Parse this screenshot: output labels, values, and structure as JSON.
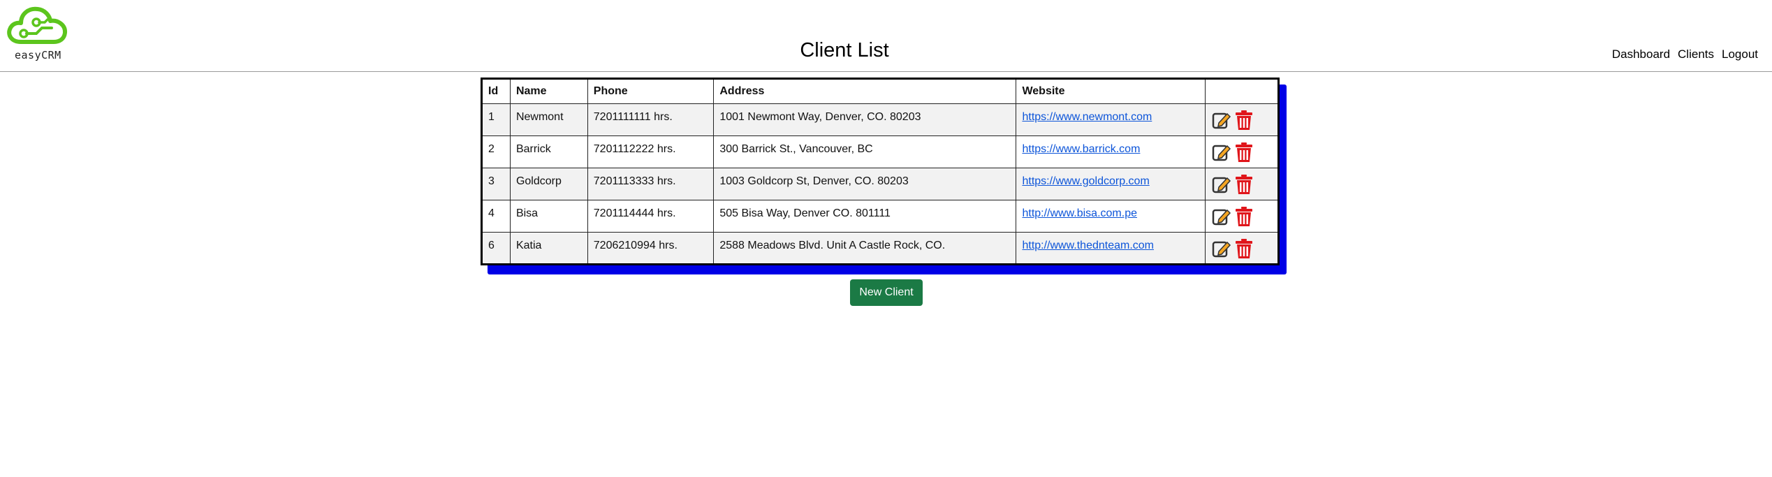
{
  "brand": {
    "name": "easyCRM",
    "logo_color": "#5cc51d"
  },
  "page_title": "Client List",
  "nav": [
    "Dashboard",
    "Clients",
    "Logout"
  ],
  "table": {
    "columns": [
      "Id",
      "Name",
      "Phone",
      "Address",
      "Website",
      ""
    ],
    "rows": [
      {
        "id": "1",
        "name": "Newmont",
        "phone": "7201111111 hrs.",
        "address": "1001 Newmont Way, Denver, CO. 80203",
        "website": "https://www.newmont.com"
      },
      {
        "id": "2",
        "name": "Barrick",
        "phone": "7201112222 hrs.",
        "address": "300 Barrick St., Vancouver, BC",
        "website": "https://www.barrick.com"
      },
      {
        "id": "3",
        "name": "Goldcorp",
        "phone": "7201113333 hrs.",
        "address": "1003 Goldcorp St, Denver, CO. 80203",
        "website": "https://www.goldcorp.com"
      },
      {
        "id": "4",
        "name": "Bisa",
        "phone": "7201114444 hrs.",
        "address": "505 Bisa Way, Denver CO. 801111",
        "website": "http://www.bisa.com.pe"
      },
      {
        "id": "6",
        "name": "Katia",
        "phone": "7206210994 hrs.",
        "address": "2588 Meadows Blvd. Unit A Castle Rock, CO.",
        "website": "http://www.thednteam.com"
      }
    ],
    "row_actions": [
      {
        "icon": "edit-icon",
        "color": "#f5a623"
      },
      {
        "icon": "trash-icon",
        "color": "#e0161b"
      }
    ],
    "shadow_color": "#0000e6"
  },
  "new_client_button": {
    "label": "New Client",
    "color": "#1b7a45"
  }
}
